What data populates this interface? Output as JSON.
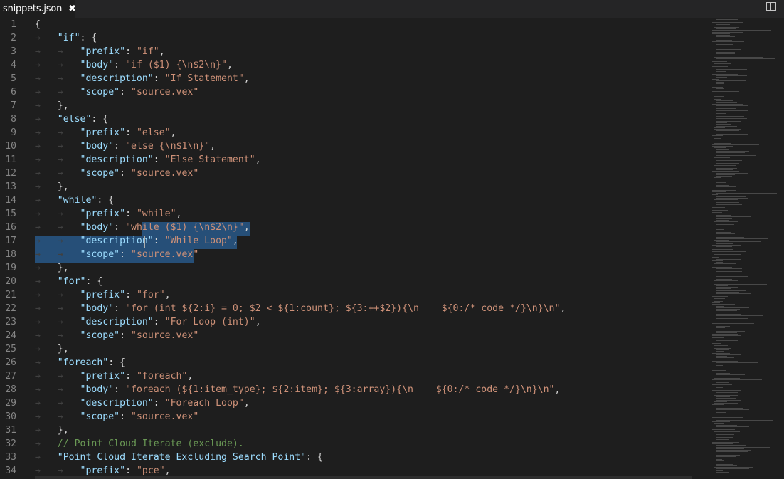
{
  "tab": {
    "title": "snippets.json",
    "close": "✖"
  },
  "line_numbers": [
    "1",
    "2",
    "3",
    "4",
    "5",
    "6",
    "7",
    "8",
    "9",
    "10",
    "11",
    "12",
    "13",
    "14",
    "15",
    "16",
    "17",
    "18",
    "19",
    "20",
    "21",
    "22",
    "23",
    "24",
    "25",
    "26",
    "27",
    "28",
    "29",
    "30",
    "31",
    "32",
    "33",
    "34"
  ],
  "lines": [
    [
      [
        "p",
        "{"
      ]
    ],
    [
      [
        "w",
        "→   "
      ],
      [
        "k",
        "\"if\""
      ],
      [
        "p",
        ": {"
      ]
    ],
    [
      [
        "w",
        "→   →   "
      ],
      [
        "k",
        "\"prefix\""
      ],
      [
        "p",
        ": "
      ],
      [
        "s",
        "\"if\""
      ],
      [
        "p",
        ","
      ]
    ],
    [
      [
        "w",
        "→   →   "
      ],
      [
        "k",
        "\"body\""
      ],
      [
        "p",
        ": "
      ],
      [
        "s",
        "\"if ($1) {\\n$2\\n}\""
      ],
      [
        "p",
        ","
      ]
    ],
    [
      [
        "w",
        "→   →   "
      ],
      [
        "k",
        "\"description\""
      ],
      [
        "p",
        ": "
      ],
      [
        "s",
        "\"If Statement\""
      ],
      [
        "p",
        ","
      ]
    ],
    [
      [
        "w",
        "→   →   "
      ],
      [
        "k",
        "\"scope\""
      ],
      [
        "p",
        ": "
      ],
      [
        "s",
        "\"source.vex\""
      ]
    ],
    [
      [
        "w",
        "→   "
      ],
      [
        "p",
        "},"
      ]
    ],
    [
      [
        "w",
        "→   "
      ],
      [
        "k",
        "\"else\""
      ],
      [
        "p",
        ": {"
      ]
    ],
    [
      [
        "w",
        "→   →   "
      ],
      [
        "k",
        "\"prefix\""
      ],
      [
        "p",
        ": "
      ],
      [
        "s",
        "\"else\""
      ],
      [
        "p",
        ","
      ]
    ],
    [
      [
        "w",
        "→   →   "
      ],
      [
        "k",
        "\"body\""
      ],
      [
        "p",
        ": "
      ],
      [
        "s",
        "\"else {\\n$1\\n}\""
      ],
      [
        "p",
        ","
      ]
    ],
    [
      [
        "w",
        "→   →   "
      ],
      [
        "k",
        "\"description\""
      ],
      [
        "p",
        ": "
      ],
      [
        "s",
        "\"Else Statement\""
      ],
      [
        "p",
        ","
      ]
    ],
    [
      [
        "w",
        "→   →   "
      ],
      [
        "k",
        "\"scope\""
      ],
      [
        "p",
        ": "
      ],
      [
        "s",
        "\"source.vex\""
      ]
    ],
    [
      [
        "w",
        "→   "
      ],
      [
        "p",
        "},"
      ]
    ],
    [
      [
        "w",
        "→   "
      ],
      [
        "k",
        "\"while\""
      ],
      [
        "p",
        ": {"
      ]
    ],
    [
      [
        "w",
        "→   →   "
      ],
      [
        "k",
        "\"prefix\""
      ],
      [
        "p",
        ": "
      ],
      [
        "s",
        "\"while\""
      ],
      [
        "p",
        ","
      ]
    ],
    [
      [
        "w",
        "→   →   "
      ],
      [
        "k",
        "\"body\""
      ],
      [
        "p",
        ": "
      ],
      [
        "s",
        "\"while ($1) {\\n$2\\n}\""
      ],
      [
        "p",
        ","
      ]
    ],
    [
      [
        "w",
        "→   →   "
      ],
      [
        "k",
        "\"description\""
      ],
      [
        "p",
        ": "
      ],
      [
        "s",
        "\"While Loop\""
      ],
      [
        "p",
        ","
      ]
    ],
    [
      [
        "w",
        "→   →   "
      ],
      [
        "k",
        "\"scope\""
      ],
      [
        "p",
        ": "
      ],
      [
        "s",
        "\"source.vex\""
      ]
    ],
    [
      [
        "w",
        "→   "
      ],
      [
        "p",
        "},"
      ]
    ],
    [
      [
        "w",
        "→   "
      ],
      [
        "k",
        "\"for\""
      ],
      [
        "p",
        ": {"
      ]
    ],
    [
      [
        "w",
        "→   →   "
      ],
      [
        "k",
        "\"prefix\""
      ],
      [
        "p",
        ": "
      ],
      [
        "s",
        "\"for\""
      ],
      [
        "p",
        ","
      ]
    ],
    [
      [
        "w",
        "→   →   "
      ],
      [
        "k",
        "\"body\""
      ],
      [
        "p",
        ": "
      ],
      [
        "s",
        "\"for (int ${2:i} = 0; $2 < ${1:count}; ${3:++$2}){\\n    ${0:/* code */}\\n}\\n\""
      ],
      [
        "p",
        ","
      ]
    ],
    [
      [
        "w",
        "→   →   "
      ],
      [
        "k",
        "\"description\""
      ],
      [
        "p",
        ": "
      ],
      [
        "s",
        "\"For Loop (int)\""
      ],
      [
        "p",
        ","
      ]
    ],
    [
      [
        "w",
        "→   →   "
      ],
      [
        "k",
        "\"scope\""
      ],
      [
        "p",
        ": "
      ],
      [
        "s",
        "\"source.vex\""
      ]
    ],
    [
      [
        "w",
        "→   "
      ],
      [
        "p",
        "},"
      ]
    ],
    [
      [
        "w",
        "→   "
      ],
      [
        "k",
        "\"foreach\""
      ],
      [
        "p",
        ": {"
      ]
    ],
    [
      [
        "w",
        "→   →   "
      ],
      [
        "k",
        "\"prefix\""
      ],
      [
        "p",
        ": "
      ],
      [
        "s",
        "\"foreach\""
      ],
      [
        "p",
        ","
      ]
    ],
    [
      [
        "w",
        "→   →   "
      ],
      [
        "k",
        "\"body\""
      ],
      [
        "p",
        ": "
      ],
      [
        "s",
        "\"foreach (${1:item_type}; ${2:item}; ${3:array}){\\n    ${0:/* code */}\\n}\\n\""
      ],
      [
        "p",
        ","
      ]
    ],
    [
      [
        "w",
        "→   →   "
      ],
      [
        "k",
        "\"description\""
      ],
      [
        "p",
        ": "
      ],
      [
        "s",
        "\"Foreach Loop\""
      ],
      [
        "p",
        ","
      ]
    ],
    [
      [
        "w",
        "→   →   "
      ],
      [
        "k",
        "\"scope\""
      ],
      [
        "p",
        ": "
      ],
      [
        "s",
        "\"source.vex\""
      ]
    ],
    [
      [
        "w",
        "→   "
      ],
      [
        "p",
        "},"
      ]
    ],
    [
      [
        "w",
        "→   "
      ],
      [
        "c",
        "// Point Cloud Iterate (exclude)."
      ]
    ],
    [
      [
        "w",
        "→   "
      ],
      [
        "k",
        "\"Point Cloud Iterate Excluding Search Point\""
      ],
      [
        "p",
        ": {"
      ]
    ],
    [
      [
        "w",
        "→   →   "
      ],
      [
        "k",
        "\"prefix\""
      ],
      [
        "p",
        ": "
      ],
      [
        "s",
        "\"pce\""
      ],
      [
        "p",
        ","
      ]
    ]
  ]
}
